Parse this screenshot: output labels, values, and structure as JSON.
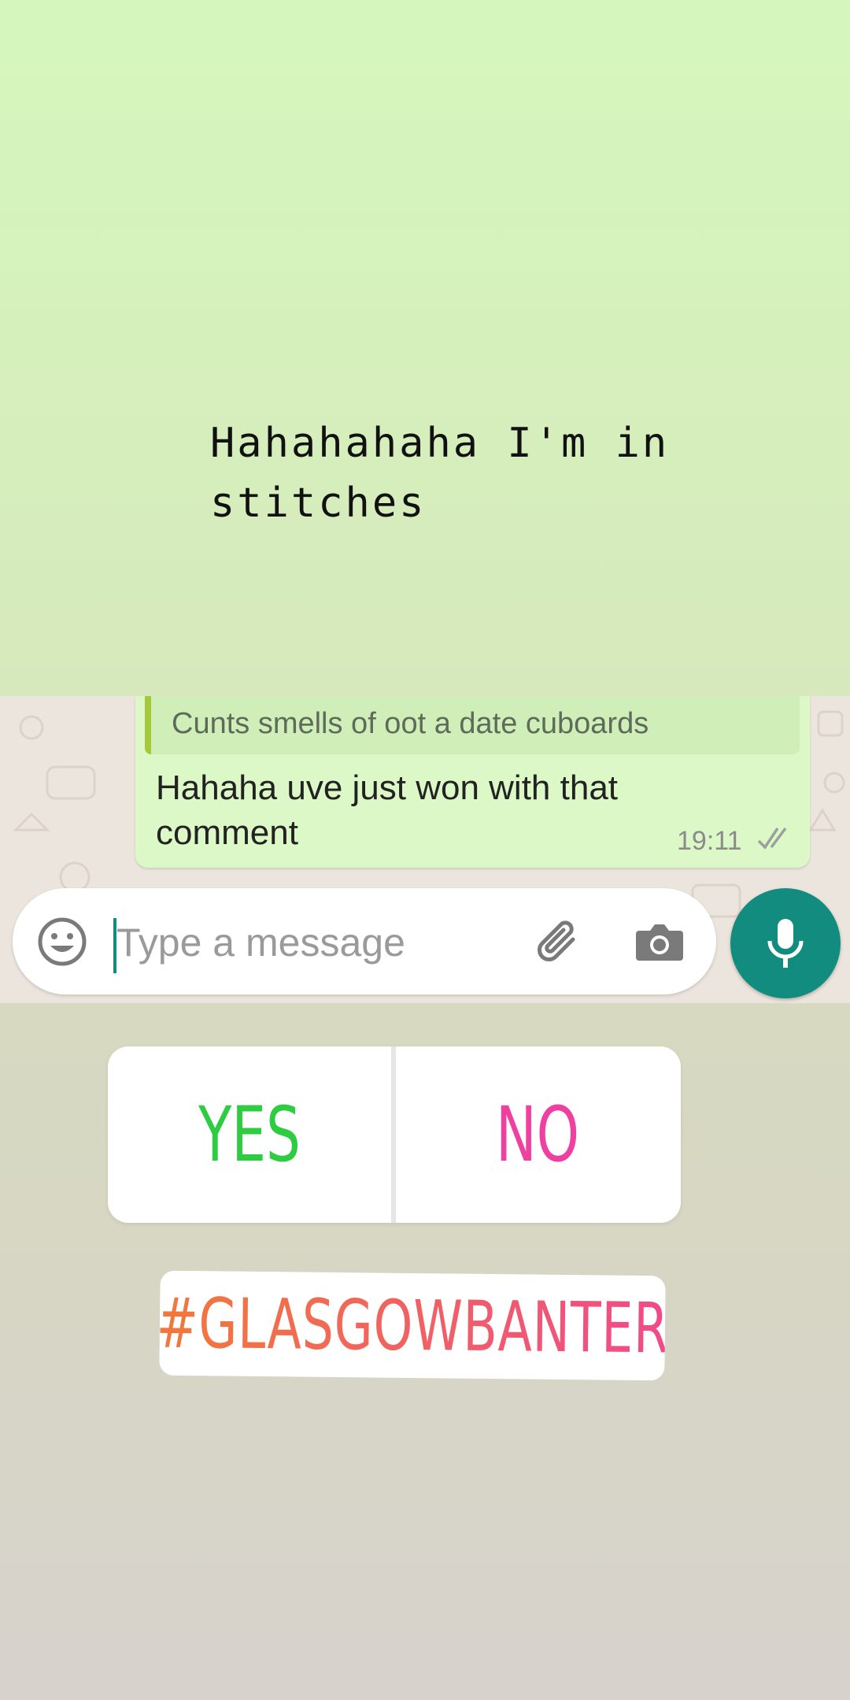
{
  "story": {
    "caption": "Hahahahaha I'm in\nstitches"
  },
  "chat": {
    "message": {
      "quoted_text": "Cunts smells of oot a date cuboards",
      "text": "Hahaha uve just won with that comment",
      "time": "19:11",
      "status_icon": "double-tick-icon"
    },
    "composer": {
      "placeholder": "Type a message",
      "left_icon": "emoji-icon",
      "icons": [
        "paperclip-icon",
        "camera-icon"
      ],
      "send_icon": "microphone-icon"
    },
    "colors": {
      "bubble": "#dcf8c6",
      "quote_bar": "#a5c73a",
      "accent": "#128c7e"
    }
  },
  "poll": {
    "yes_label": "YES",
    "no_label": "NO",
    "yes_color": "#2ecc40",
    "no_color": "#ef3fa0"
  },
  "hashtag": {
    "text": "#GLASGOWBANTER"
  }
}
